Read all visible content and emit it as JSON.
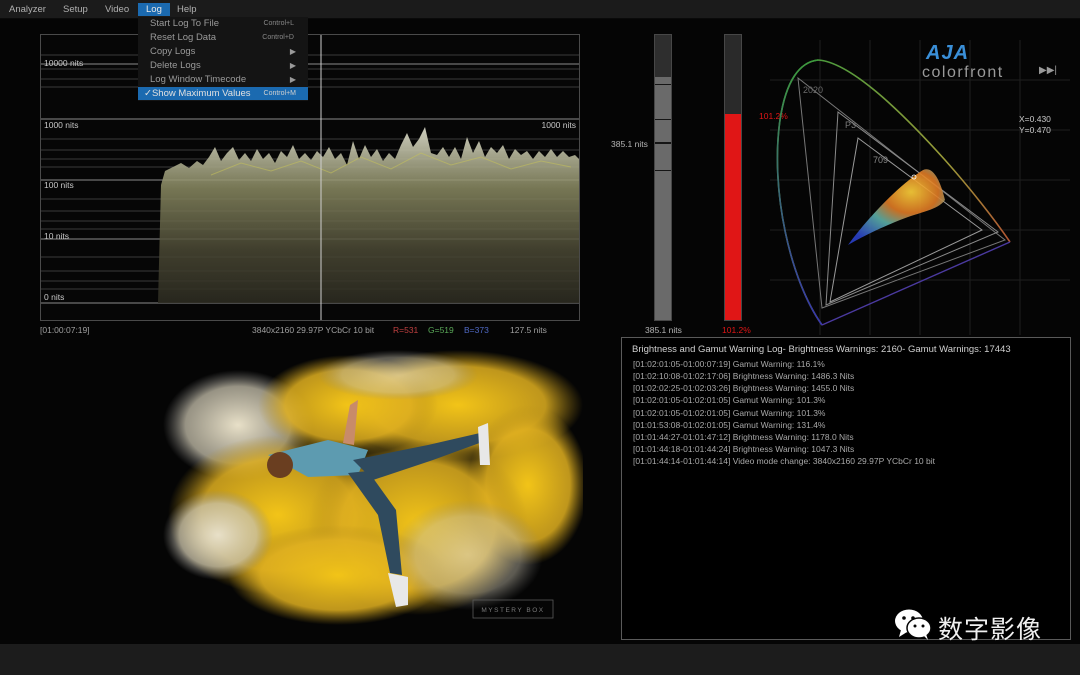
{
  "menubar": {
    "items": [
      "Analyzer",
      "Setup",
      "Video",
      "Log",
      "Help"
    ]
  },
  "log_menu": {
    "items": [
      {
        "label": "Start Log To File",
        "shortcut": "Control+L"
      },
      {
        "label": "Reset Log Data",
        "shortcut": "Control+D"
      },
      {
        "label": "Copy Logs",
        "shortcut": "▶"
      },
      {
        "label": "Delete Logs",
        "shortcut": "▶"
      },
      {
        "label": "Log Window Timecode",
        "shortcut": "▶"
      },
      {
        "label": "✓Show Maximum Values",
        "shortcut": "Control+M"
      }
    ]
  },
  "waveform": {
    "labels": [
      "10000 nits",
      "1000 nits",
      "1000 nits",
      "100 nits",
      "10 nits",
      "0 nits"
    ],
    "timecode": "[01:00:07:19]",
    "video_mode": "3840x2160 29.97P YCbCr 10 bit",
    "r": "R=531",
    "g": "G=519",
    "b": "B=373",
    "nits_value": "127.5 nits",
    "colors": {
      "r": "#c04040",
      "g": "#5aa858",
      "b": "#4f69c4"
    }
  },
  "meters": {
    "brightness_side_label": "385.1 nits",
    "brightness_bottom": "385.1 nits",
    "brightness_level": 0.853,
    "gamut_side_label": "101.2%",
    "gamut_bottom": "101.2%",
    "gamut_color": "#e01616",
    "gamut_level": 0.722
  },
  "gamut": {
    "labels": [
      "2020",
      "P3",
      "709"
    ],
    "x_value": "X=0.430",
    "y_value": "Y=0.470"
  },
  "logo": {
    "brand": "AJA",
    "product": "colorfront"
  },
  "image": {
    "watermark": "MYSTERY BOX"
  },
  "log_panel": {
    "title": "Brightness and Gamut Warning Log- Brightness Warnings: 2160- Gamut Warnings: 17443",
    "lines": [
      "[01:02:01:05-01:00:07:19] Gamut Warning: 116.1%",
      "[01:02:10:08-01:02:17:06] Brightness Warning: 1486.3 Nits",
      "[01:02:02:25-01:02:03:26] Brightness Warning: 1455.0 Nits",
      "[01:02:01:05-01:02:01:05] Gamut Warning: 101.3%",
      "[01:02:01:05-01:02:01:05] Gamut Warning: 101.3%",
      "[01:01:53:08-01:02:01:05] Gamut Warning: 131.4%",
      "[01:01:44:27-01:01:47:12] Brightness Warning: 1178.0 Nits",
      "[01:01:44:18-01:01:44:24] Brightness Warning: 1047.3 Nits",
      "[01:01:44:14-01:01:44:14] Video mode change: 3840x2160 29.97P YCbCr 10 bit"
    ]
  },
  "wechat": {
    "name": "数字影像"
  }
}
